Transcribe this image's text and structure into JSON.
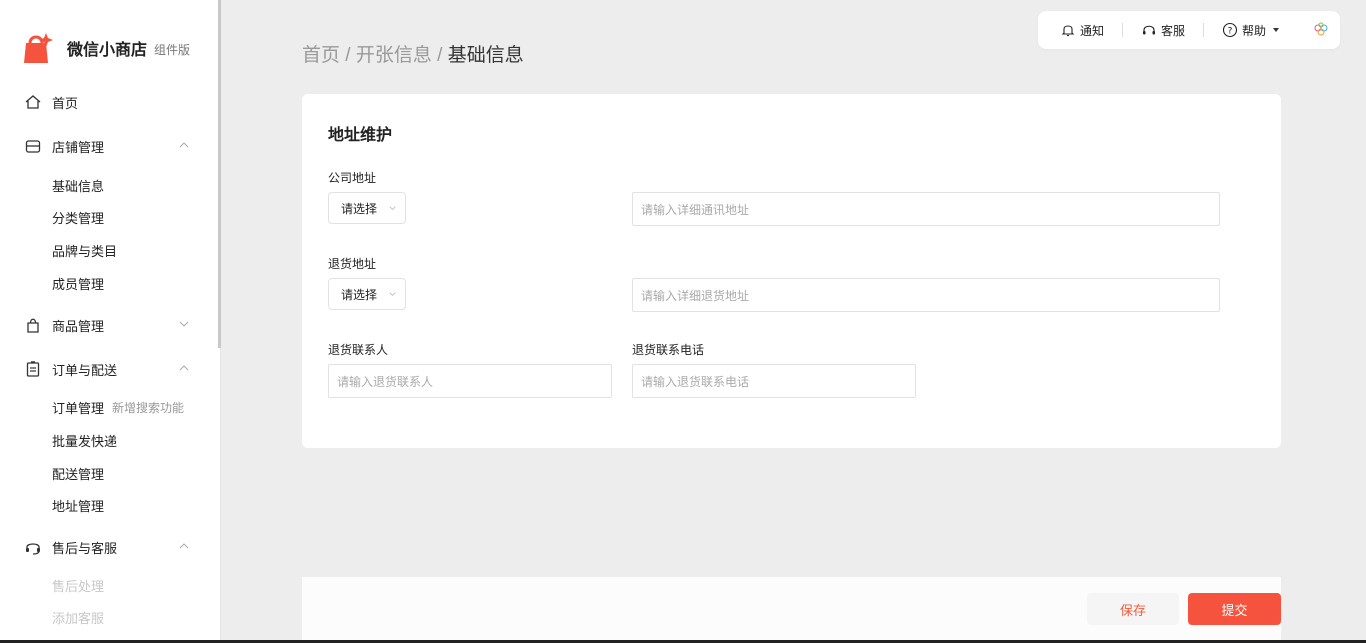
{
  "brand": {
    "name": "微信小商店",
    "sub": "组件版",
    "color": "#f5533d"
  },
  "nav": {
    "home": "首页",
    "store": "店铺管理",
    "store_items": [
      "基础信息",
      "分类管理",
      "品牌与类目",
      "成员管理"
    ],
    "goods": "商品管理",
    "orders": "订单与配送",
    "order_items": [
      "订单管理",
      "批量发快递",
      "配送管理",
      "地址管理"
    ],
    "order_tag": "新增搜索功能",
    "after": "售后与客服",
    "after_items": [
      "售后处理",
      "添加客服"
    ]
  },
  "toolbar": {
    "notify": "通知",
    "service": "客服",
    "help": "帮助"
  },
  "breadcrumb": {
    "home": "首页",
    "sep": "/",
    "open": "开张信息",
    "current": "基础信息"
  },
  "card": {
    "title": "地址维护",
    "company_label": "公司地址",
    "return_label": "退货地址",
    "select_value": "请选择",
    "company_placeholder": "请输入详细通讯地址",
    "return_placeholder": "请输入详细退货地址",
    "contact_label": "退货联系人",
    "contact_placeholder": "请输入退货联系人",
    "phone_label": "退货联系电话",
    "phone_placeholder": "请输入退货联系电话"
  },
  "actions": {
    "save": "保存",
    "submit": "提交"
  }
}
